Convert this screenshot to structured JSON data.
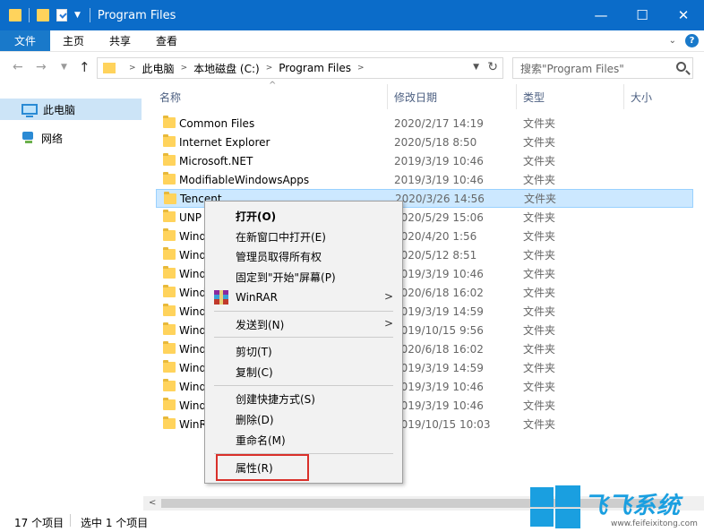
{
  "window": {
    "title": "Program Files",
    "minimize_icon": "minimize-icon",
    "maximize_icon": "maximize-icon",
    "close_icon": "close-icon"
  },
  "ribbon": {
    "tabs": [
      "文件",
      "主页",
      "共享",
      "查看"
    ],
    "help_label": "?"
  },
  "address": {
    "crumbs": [
      "此电脑",
      "本地磁盘 (C:)",
      "Program Files"
    ],
    "search_placeholder": "搜索\"Program Files\""
  },
  "sidebar": {
    "items": [
      {
        "label": "此电脑",
        "icon": "pc-icon",
        "selected": true
      },
      {
        "label": "网络",
        "icon": "network-icon",
        "selected": false
      }
    ]
  },
  "columns": {
    "name": "名称",
    "date": "修改日期",
    "type": "类型",
    "size": "大小"
  },
  "files": [
    {
      "name": "Common Files",
      "date": "2020/2/17 14:19",
      "type": "文件夹"
    },
    {
      "name": "Internet Explorer",
      "date": "2020/5/18 8:50",
      "type": "文件夹"
    },
    {
      "name": "Microsoft.NET",
      "date": "2019/3/19 10:46",
      "type": "文件夹"
    },
    {
      "name": "ModifiableWindowsApps",
      "date": "2019/3/19 10:46",
      "type": "文件夹"
    },
    {
      "name": "Tencent",
      "date": "2020/3/26 14:56",
      "type": "文件夹",
      "selected": true
    },
    {
      "name": "UNP",
      "date": "2020/5/29 15:06",
      "type": "文件夹"
    },
    {
      "name": "Wind",
      "date": "2020/4/20 1:56",
      "type": "文件夹"
    },
    {
      "name": "Wind",
      "date": "2020/5/12 8:51",
      "type": "文件夹"
    },
    {
      "name": "Wind",
      "date": "2019/3/19 10:46",
      "type": "文件夹"
    },
    {
      "name": "Wind",
      "date": "2020/6/18 16:02",
      "type": "文件夹"
    },
    {
      "name": "Wind",
      "date": "2019/3/19 14:59",
      "type": "文件夹"
    },
    {
      "name": "Wind",
      "date": "2019/10/15 9:56",
      "type": "文件夹"
    },
    {
      "name": "Wind",
      "date": "2020/6/18 16:02",
      "type": "文件夹"
    },
    {
      "name": "Wind",
      "date": "2019/3/19 14:59",
      "type": "文件夹"
    },
    {
      "name": "Wind",
      "date": "2019/3/19 10:46",
      "type": "文件夹"
    },
    {
      "name": "Wind",
      "date": "2019/3/19 10:46",
      "type": "文件夹"
    },
    {
      "name": "WinR",
      "date": "2019/10/15 10:03",
      "type": "文件夹"
    }
  ],
  "context_menu": {
    "open": "打开(O)",
    "open_new_window": "在新窗口中打开(E)",
    "take_ownership": "管理员取得所有权",
    "pin_start": "固定到\"开始\"屏幕(P)",
    "winrar": "WinRAR",
    "send_to": "发送到(N)",
    "cut": "剪切(T)",
    "copy": "复制(C)",
    "create_shortcut": "创建快捷方式(S)",
    "delete": "删除(D)",
    "rename": "重命名(M)",
    "properties": "属性(R)"
  },
  "status": {
    "count": "17 个项目",
    "selected": "选中 1 个项目"
  },
  "watermark": {
    "title": "飞飞系统",
    "url": "www.feifeixitong.com"
  },
  "colors": {
    "titlebar": "#0b6cc9",
    "file_tab": "#1979ca",
    "selection": "#cce8ff",
    "highlight_border": "#d9302a"
  }
}
